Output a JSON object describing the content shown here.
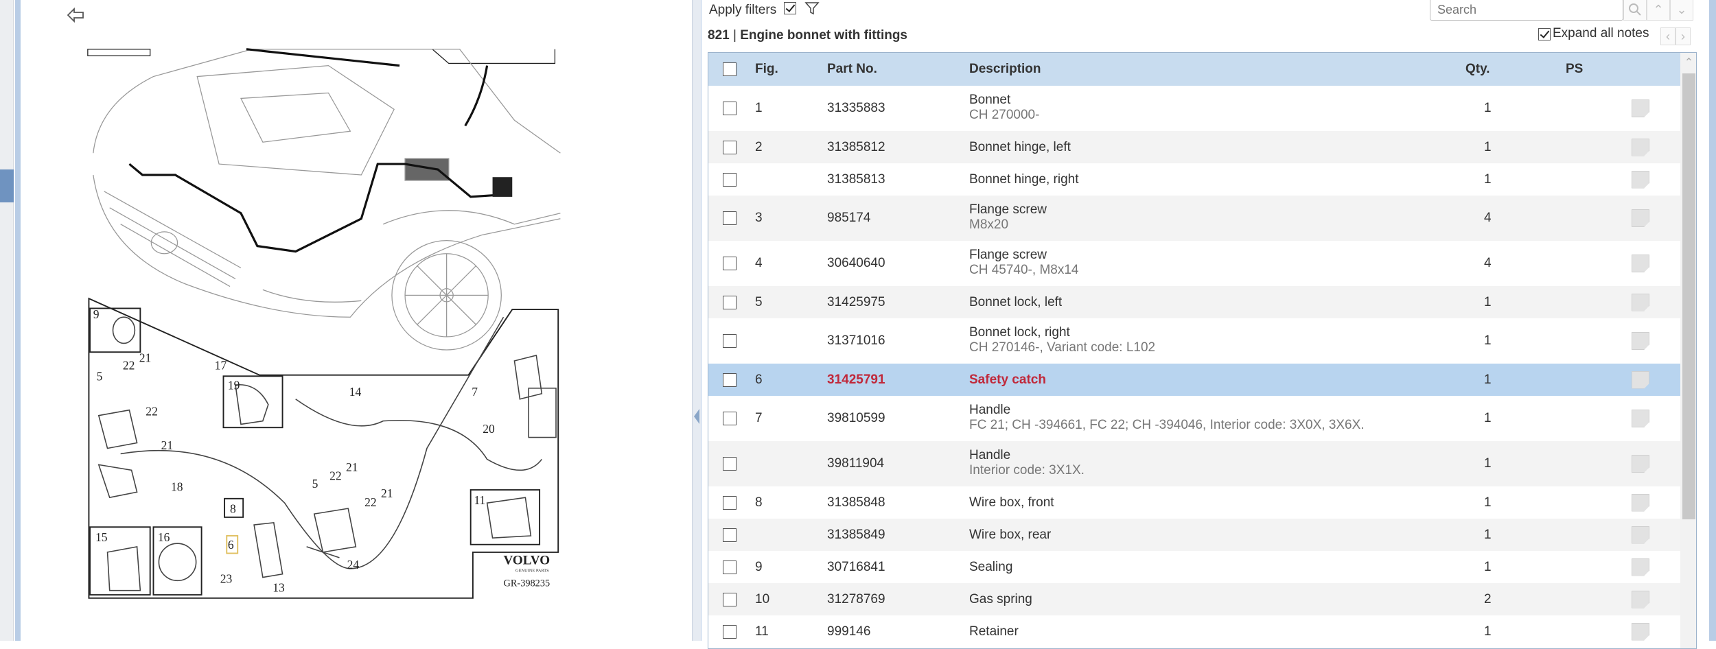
{
  "toolbar": {
    "apply_filters": "Apply filters",
    "apply_filters_checked": true,
    "search_placeholder": "Search",
    "expand_all_notes": "Expand all notes",
    "expand_checked": true
  },
  "section": {
    "number": "821",
    "separator": "|",
    "title": "Engine bonnet with fittings"
  },
  "columns": {
    "fig": "Fig.",
    "part_no": "Part No.",
    "description": "Description",
    "qty": "Qty.",
    "ps": "PS"
  },
  "rows": [
    {
      "fig": "1",
      "part": "31335883",
      "desc": "Bonnet",
      "sub": "CH 270000-",
      "qty": "1"
    },
    {
      "fig": "2",
      "part": "31385812",
      "desc": "Bonnet hinge, left",
      "sub": "",
      "qty": "1"
    },
    {
      "fig": "",
      "part": "31385813",
      "desc": "Bonnet hinge, right",
      "sub": "",
      "qty": "1"
    },
    {
      "fig": "3",
      "part": "985174",
      "desc": "Flange screw",
      "sub": "M8x20",
      "qty": "4"
    },
    {
      "fig": "4",
      "part": "30640640",
      "desc": "Flange screw",
      "sub": "CH 45740-, M8x14",
      "qty": "4"
    },
    {
      "fig": "5",
      "part": "31425975",
      "desc": "Bonnet lock, left",
      "sub": "",
      "qty": "1"
    },
    {
      "fig": "",
      "part": "31371016",
      "desc": "Bonnet lock, right",
      "sub": "CH 270146-, Variant code: L102",
      "qty": "1"
    },
    {
      "fig": "6",
      "part": "31425791",
      "desc": "Safety catch",
      "sub": "",
      "qty": "1",
      "selected": true
    },
    {
      "fig": "7",
      "part": "39810599",
      "desc": "Handle",
      "sub": "FC 21; CH -394661, FC 22; CH -394046, Interior code: 3X0X, 3X6X.",
      "qty": "1"
    },
    {
      "fig": "",
      "part": "39811904",
      "desc": "Handle",
      "sub": "Interior code: 3X1X.",
      "qty": "1"
    },
    {
      "fig": "8",
      "part": "31385848",
      "desc": "Wire box, front",
      "sub": "",
      "qty": "1"
    },
    {
      "fig": "",
      "part": "31385849",
      "desc": "Wire box, rear",
      "sub": "",
      "qty": "1"
    },
    {
      "fig": "9",
      "part": "30716841",
      "desc": "Sealing",
      "sub": "",
      "qty": "1"
    },
    {
      "fig": "10",
      "part": "31278769",
      "desc": "Gas spring",
      "sub": "",
      "qty": "2"
    },
    {
      "fig": "11",
      "part": "999146",
      "desc": "Retainer",
      "sub": "",
      "qty": "1"
    }
  ],
  "diagram": {
    "callouts": [
      "9",
      "22",
      "21",
      "17",
      "5",
      "19",
      "14",
      "7",
      "22",
      "21",
      "20",
      "18",
      "11",
      "21",
      "22",
      "5",
      "21",
      "22",
      "8",
      "15",
      "16",
      "6",
      "24",
      "23",
      "13"
    ],
    "brand": "VOLVO",
    "brand_sub": "GENUINE PARTS",
    "ref": "GR-398235"
  },
  "colors": {
    "header_bg": "#c8dcef",
    "selected_bg": "#b8d4ef",
    "selected_text": "#c0283a",
    "border_blue": "#b9cde6"
  }
}
